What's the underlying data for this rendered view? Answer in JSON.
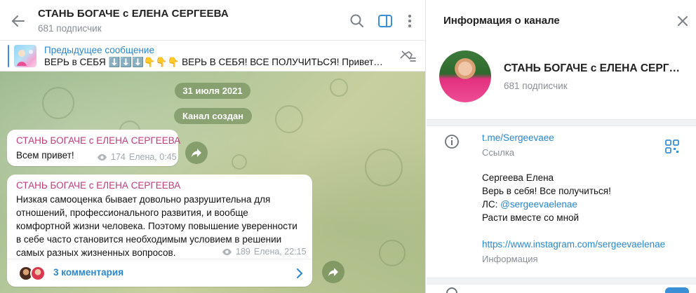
{
  "chat": {
    "title": "СТАНЬ БОГАЧЕ с ЕЛЕНА СЕРГЕЕВА",
    "subscribers": "681 подписчик",
    "icons": [
      "back-arrow-icon",
      "search-icon",
      "sidebar-toggle-icon",
      "more-vertical-icon"
    ]
  },
  "pinned": {
    "title": "Предыдущее сообщение",
    "text": "ВЕРЬ в СЕБЯ ⬇️⬇️⬇️👇👇👇  ВЕРЬ В СЕБЯ! ВСЕ ПОЛУЧИТЬСЯ!  Привет Дру…",
    "icon": "pinned-list-icon"
  },
  "feed": {
    "date": "31 июля 2021",
    "service": "Канал создан",
    "messages": [
      {
        "sender": "СТАНЬ БОГАЧЕ с ЕЛЕНА СЕРГЕЕВА",
        "text": "Всем привет!",
        "views": "174",
        "meta": "Елена, 0:45"
      },
      {
        "sender": "СТАНЬ БОГАЧЕ с ЕЛЕНА СЕРГЕЕВА",
        "lines": [
          "Низкая самооценка бывает довольно разрушительна для",
          "отношений, профессионального развития, и вообще",
          "комфортной жизни человека. Поэтому повышение уверенности",
          "в себе часто становится необходимым условием в решении",
          "самых разных жизненных вопросов."
        ],
        "views": "189",
        "meta": "Елена, 22:15",
        "comments": "3 комментария"
      }
    ]
  },
  "info": {
    "title": "Информация о канале",
    "name": "СТАНЬ БОГАЧЕ с ЕЛЕНА СЕРГЕЕВА",
    "subscribers": "681 подписчик",
    "link": "t.me/Sergeevaee",
    "link_label": "Ссылка",
    "about": {
      "line1": "Сергеева Елена",
      "line2": "Верь в себя! Все получиться!",
      "line3_prefix": "ЛС: ",
      "line3_mention": "@sergeevaelenae",
      "line4": "Расти вместе со мной",
      "instagram": "https://www.instagram.com/sergeevaelenae",
      "label": "Информация"
    }
  },
  "colors": {
    "accent": "#2a87d0",
    "sender": "#c03d7c",
    "chat_bg": "#b3c79a"
  }
}
